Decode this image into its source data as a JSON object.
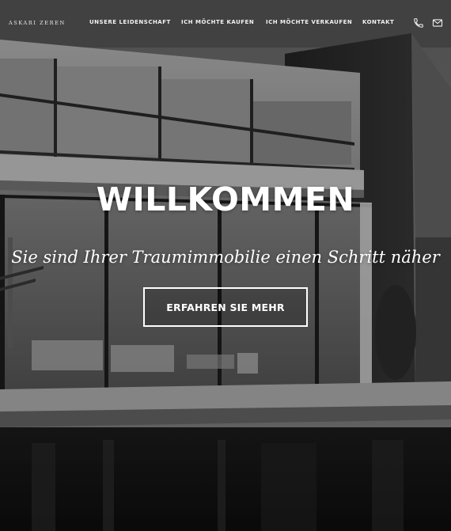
{
  "brand": {
    "logo_text": "ASKARI ZEREN"
  },
  "nav": {
    "items": [
      {
        "label": "UNSERE LEIDENSCHAFT"
      },
      {
        "label": "ICH MÖCHTE KAUFEN"
      },
      {
        "label": "ICH MÖCHTE VERKAUFEN"
      },
      {
        "label": "KONTAKT"
      }
    ],
    "icons": [
      "phone-icon",
      "mail-icon"
    ]
  },
  "hero": {
    "title": "WILLKOMMEN",
    "subtitle": "Sie sind Ihrer Traumimmobilie einen Schritt näher",
    "cta_label": "ERFAHREN SIE MEHR"
  },
  "colors": {
    "text": "#ffffff",
    "overlay": "#000000"
  }
}
